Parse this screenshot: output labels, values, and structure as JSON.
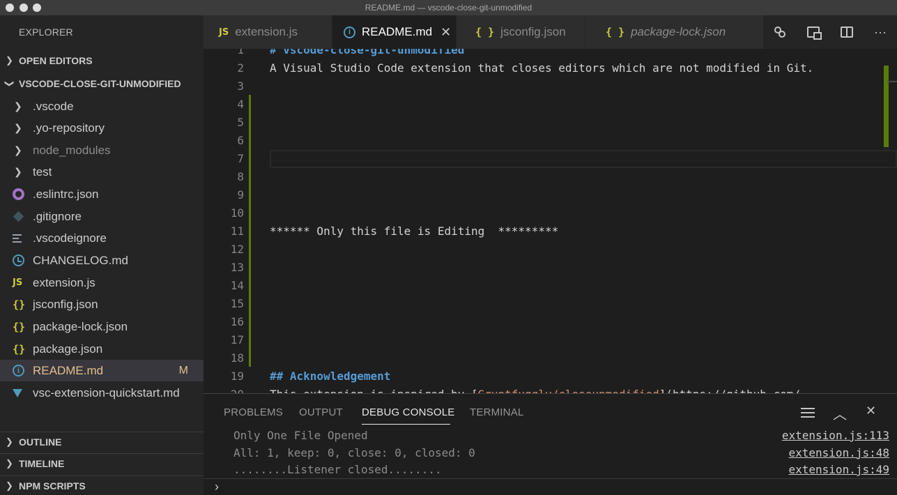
{
  "window": {
    "title": "README.md — vscode-close-git-unmodified"
  },
  "sidebar": {
    "header": "EXPLORER",
    "open_editors": "OPEN EDITORS",
    "project": "VSCODE-CLOSE-GIT-UNMODIFIED",
    "tree": [
      {
        "label": ".vscode",
        "type": "folder",
        "icon": "chevron-right-icon"
      },
      {
        "label": ".yo-repository",
        "type": "folder",
        "icon": "chevron-right-icon"
      },
      {
        "label": "node_modules",
        "type": "folder",
        "icon": "chevron-right-icon"
      },
      {
        "label": "test",
        "type": "folder",
        "icon": "chevron-right-icon"
      },
      {
        "label": ".eslintrc.json",
        "type": "file",
        "icon": "eslint-icon"
      },
      {
        "label": ".gitignore",
        "type": "file",
        "icon": "git-icon"
      },
      {
        "label": ".vscodeignore",
        "type": "file",
        "icon": "lines-icon"
      },
      {
        "label": "CHANGELOG.md",
        "type": "file",
        "icon": "clock-icon"
      },
      {
        "label": "extension.js",
        "type": "file",
        "icon": "js-icon",
        "icon_text": "JS"
      },
      {
        "label": "jsconfig.json",
        "type": "file",
        "icon": "json-icon",
        "icon_text": "{}"
      },
      {
        "label": "package-lock.json",
        "type": "file",
        "icon": "json-icon",
        "icon_text": "{}"
      },
      {
        "label": "package.json",
        "type": "file",
        "icon": "json-icon",
        "icon_text": "{}"
      },
      {
        "label": "README.md",
        "type": "file",
        "icon": "info-icon",
        "icon_text": "i",
        "badge": "M"
      },
      {
        "label": "vsc-extension-quickstart.md",
        "type": "file",
        "icon": "markdown-icon"
      }
    ],
    "outline": "OUTLINE",
    "timeline": "TIMELINE",
    "npm_scripts": "NPM SCRIPTS"
  },
  "tabs": [
    {
      "label": "extension.js",
      "icon_text": "JS"
    },
    {
      "label": "README.md",
      "icon_text": "i",
      "close": "✕"
    },
    {
      "label": "jsconfig.json",
      "icon_text": "{ }"
    },
    {
      "label": "package-lock.json",
      "icon_text": "{ }"
    }
  ],
  "tab_actions": [
    "compare-changes-icon",
    "open-preview-icon",
    "split-editor-icon",
    "more-actions-icon"
  ],
  "more_actions_glyph": "···",
  "editor": {
    "lines": [
      {
        "num": "1",
        "text": "# vscode-close-git-unmodified"
      },
      {
        "num": "2",
        "text": "A Visual Studio Code extension that closes editors which are not modified in Git."
      },
      {
        "num": "3",
        "text": ""
      },
      {
        "num": "4",
        "text": ""
      },
      {
        "num": "5",
        "text": ""
      },
      {
        "num": "6",
        "text": ""
      },
      {
        "num": "7",
        "text": ""
      },
      {
        "num": "8",
        "text": ""
      },
      {
        "num": "9",
        "text": ""
      },
      {
        "num": "10",
        "text": ""
      },
      {
        "num": "11",
        "text": "****** Only this file is Editing  *********"
      },
      {
        "num": "12",
        "text": ""
      },
      {
        "num": "13",
        "text": ""
      },
      {
        "num": "14",
        "text": ""
      },
      {
        "num": "15",
        "text": ""
      },
      {
        "num": "16",
        "text": ""
      },
      {
        "num": "17",
        "text": ""
      },
      {
        "num": "18",
        "text": ""
      },
      {
        "num": "19",
        "text": "## Acknowledgement"
      },
      {
        "num": "20",
        "text_before": "This extension is inspired by [",
        "link": "Gruntfuggly/closeunmodified",
        "text_after": "](https://github.com/"
      }
    ]
  },
  "panel": {
    "tabs": [
      "PROBLEMS",
      "OUTPUT",
      "DEBUG CONSOLE",
      "TERMINAL"
    ],
    "active_tab": "DEBUG CONSOLE",
    "actions": [
      "filter-icon",
      "chevron-up-icon",
      "close-icon"
    ],
    "chevron_up_glyph": "︿",
    "close_glyph": "✕",
    "console": [
      {
        "message": "Only One File Opened",
        "source": "extension.js:113"
      },
      {
        "message": "All: 1, keep: 0, close: 0, closed: 0",
        "source": "extension.js:48"
      },
      {
        "message": "........Listener closed........",
        "source": "extension.js:49"
      }
    ],
    "prompt": "›"
  },
  "colors": {
    "accent": "#007acc",
    "modified": "#e2c08d",
    "gutter_modified": "#587c0c",
    "heading": "#569cd6",
    "link": "#ce9178"
  }
}
